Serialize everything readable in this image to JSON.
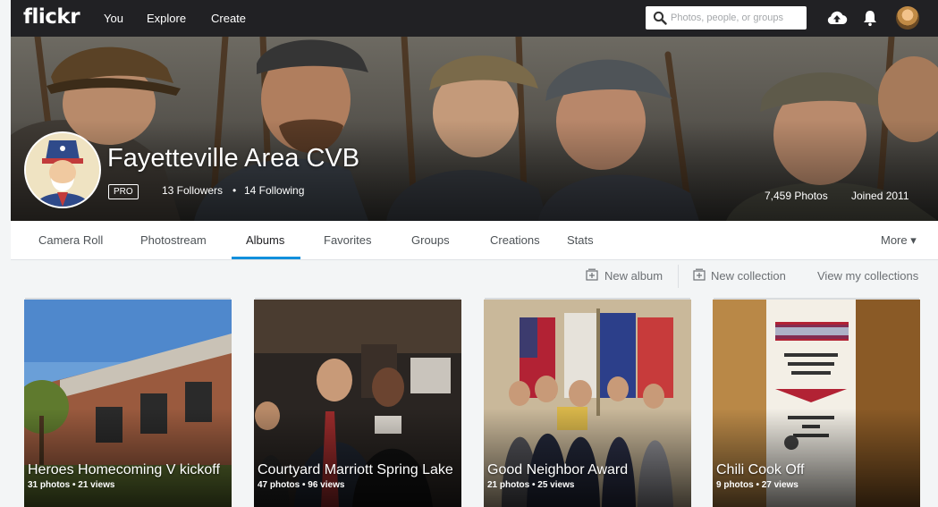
{
  "topbar": {
    "logo": "flickr",
    "nav": [
      "You",
      "Explore",
      "Create"
    ],
    "search_placeholder": "Photos, people, or groups",
    "icons": [
      "search-icon",
      "upload-cloud-icon",
      "bell-icon",
      "user-avatar"
    ]
  },
  "profile": {
    "name": "Fayetteville Area CVB",
    "badge": "PRO",
    "followers": "13 Followers",
    "separator": "•",
    "following": "14 Following",
    "photos": "7,459 Photos",
    "joined": "Joined 2011"
  },
  "tabs": [
    "Camera Roll",
    "Photostream",
    "Albums",
    "Favorites",
    "Groups",
    "Creations",
    "Stats"
  ],
  "active_tab": "Albums",
  "more_label": "More ▾",
  "actions": {
    "new_album": "New album",
    "new_collection": "New collection",
    "view_collections": "View my collections"
  },
  "albums": [
    {
      "title": "Heroes Homecoming V kickoff",
      "stats": "31 photos  •  21 views"
    },
    {
      "title": "Courtyard Marriott Spring Lake",
      "stats": "47 photos  •  96 views"
    },
    {
      "title": "Good Neighbor Award",
      "stats": "21 photos  •  25 views"
    },
    {
      "title": "Chili Cook Off",
      "stats": "9 photos  •  27 views"
    }
  ],
  "colors": {
    "topbar": "#212124",
    "accent": "#128fdc",
    "page_bg": "#f3f5f6"
  }
}
